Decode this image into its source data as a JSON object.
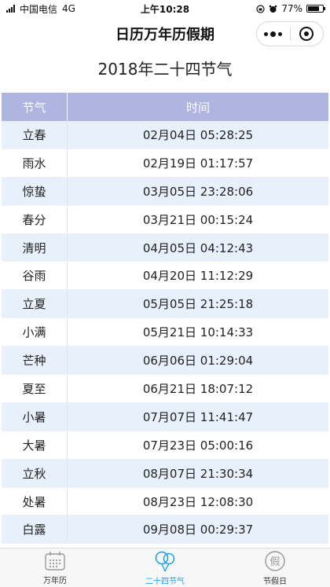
{
  "status_bar": {
    "carrier": "中国电信",
    "network": "4G",
    "time": "上午10:28",
    "battery": "77%",
    "battery_level": 0.77
  },
  "nav": {
    "title": "日历万年历假期"
  },
  "page_title": "2018年二十四节气",
  "table": {
    "headers": [
      "节气",
      "时间"
    ],
    "rows": [
      [
        "立春",
        "02月04日 05:28:25"
      ],
      [
        "雨水",
        "02月19日 01:17:57"
      ],
      [
        "惊蛰",
        "03月05日 23:28:06"
      ],
      [
        "春分",
        "03月21日 00:15:24"
      ],
      [
        "清明",
        "04月05日 04:12:43"
      ],
      [
        "谷雨",
        "04月20日 11:12:29"
      ],
      [
        "立夏",
        "05月05日 21:25:18"
      ],
      [
        "小满",
        "05月21日 10:14:33"
      ],
      [
        "芒种",
        "06月06日 01:29:04"
      ],
      [
        "夏至",
        "06月21日 18:07:12"
      ],
      [
        "小暑",
        "07月07日 11:41:47"
      ],
      [
        "大暑",
        "07月23日 05:00:16"
      ],
      [
        "立秋",
        "08月07日 21:30:34"
      ],
      [
        "处暑",
        "08月23日 12:08:30"
      ],
      [
        "白露",
        "09月08日 00:29:37"
      ]
    ]
  },
  "tabs": [
    {
      "label": "万年历",
      "icon": "calendar-icon",
      "active": false
    },
    {
      "label": "二十四节气",
      "icon": "balloons-icon",
      "active": true
    },
    {
      "label": "节假日",
      "icon": "holiday-icon",
      "active": false
    }
  ],
  "colors": {
    "header_bg": "#aeb5e0",
    "row_alt_bg": "#e8f1fb",
    "active_tab": "#1aa0e8",
    "inactive_icon": "#999999"
  },
  "icon_glyphs": {
    "holiday": "假"
  }
}
